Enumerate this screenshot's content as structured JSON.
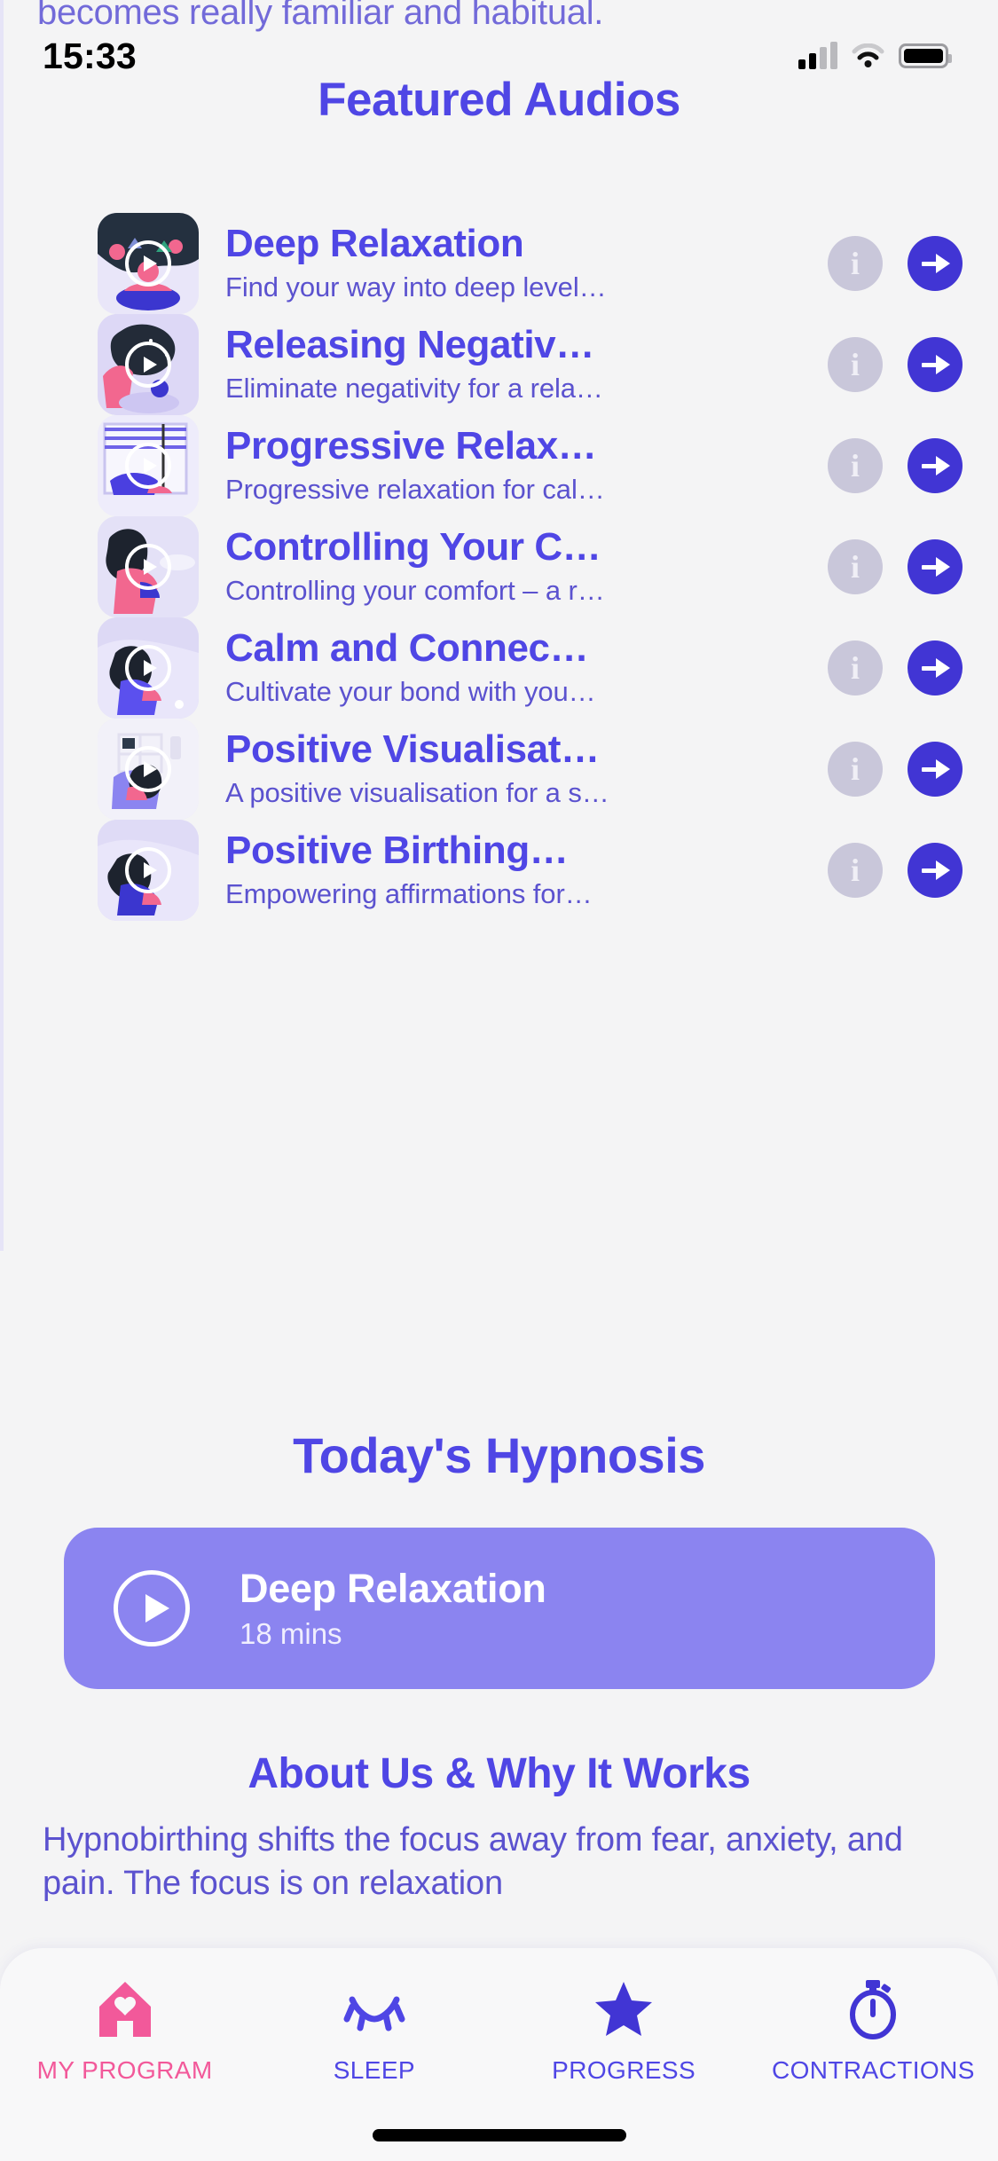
{
  "bleed_text": "becomes really familiar and habitual.",
  "status_bar": {
    "time": "15:33",
    "signal_icon": "cellular-bars-icon",
    "wifi_icon": "wifi-icon",
    "battery_icon": "battery-full-icon"
  },
  "featured": {
    "title": "Featured Audios",
    "items": [
      {
        "title": "Deep Relaxation",
        "subtitle": "Find your way into deep level…",
        "info_label": "i",
        "thumb": "meditation-night-flowers"
      },
      {
        "title": "Releasing Negativ…",
        "subtitle": "Eliminate negativity for a rela…",
        "info_label": "i",
        "thumb": "woman-night-sky-thoughts"
      },
      {
        "title": "Progressive Relax…",
        "subtitle": "Progressive relaxation for cal…",
        "info_label": "i",
        "thumb": "woman-reclining-window"
      },
      {
        "title": "Controlling Your C…",
        "subtitle": "Controlling your comfort – a r…",
        "info_label": "i",
        "thumb": "woman-holding-belly"
      },
      {
        "title": "Calm and Connec…",
        "subtitle": "Cultivate your bond with you…",
        "info_label": "i",
        "thumb": "woman-resting-calm"
      },
      {
        "title": "Positive Visualisat…",
        "subtitle": "A positive visualisation for a s…",
        "info_label": "i",
        "thumb": "woman-home-shelf"
      },
      {
        "title": "Positive Birthing…",
        "subtitle": "Empowering affirmations for…",
        "info_label": "i",
        "thumb": "woman-sitting-pillow"
      }
    ]
  },
  "today": {
    "title": "Today's Hypnosis",
    "card": {
      "name": "Deep Relaxation",
      "duration": "18 mins",
      "play_icon": "play-circle-icon"
    }
  },
  "about": {
    "title": "About Us & Why It Works",
    "body": "Hypnobirthing shifts the focus away from fear, anxiety, and pain. The focus is on relaxation"
  },
  "tabbar": {
    "items": [
      {
        "label": "MY PROGRAM",
        "icon": "home-heart-icon",
        "active": true
      },
      {
        "label": "SLEEP",
        "icon": "closed-eye-icon",
        "active": false
      },
      {
        "label": "PROGRESS",
        "icon": "star-icon",
        "active": false
      },
      {
        "label": "CONTRACTIONS",
        "icon": "stopwatch-icon",
        "active": false
      }
    ]
  },
  "colors": {
    "accent": "#4f46e5",
    "accent_deep": "#4135d4",
    "card": "#8b84f0",
    "pink": "#f2599a",
    "background": "#f4f4f5",
    "info_grey": "#c9c7da"
  }
}
